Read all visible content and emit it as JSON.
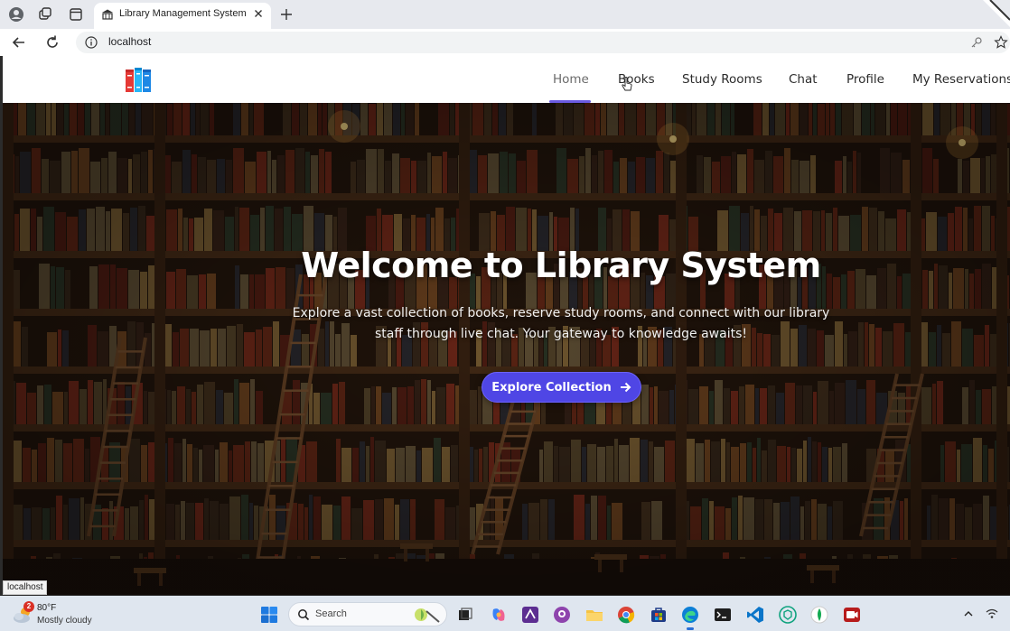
{
  "browser": {
    "tab_title": "Library Management System",
    "url": "localhost",
    "status_url": "localhost"
  },
  "site": {
    "nav": {
      "items": [
        {
          "label": "Home",
          "active": true
        },
        {
          "label": "Books",
          "active": false
        },
        {
          "label": "Study Rooms",
          "active": false
        },
        {
          "label": "Chat",
          "active": false
        },
        {
          "label": "Profile",
          "active": false
        },
        {
          "label": "My Reservations",
          "active": false
        }
      ]
    },
    "hero": {
      "title": "Welcome to Library System",
      "subtitle_line1": "Explore a vast collection of books, reserve study rooms, and connect with our library",
      "subtitle_line2": "staff through live chat. Your gateway to knowledge awaits!",
      "cta_label": "Explore Collection"
    },
    "colors": {
      "accent": "#4f46e5",
      "nav_underline": "#6a5ae0"
    }
  },
  "taskbar": {
    "weather_temp": "80°F",
    "weather_desc": "Mostly cloudy",
    "weather_badge": "2",
    "search_label": "Search",
    "apps": [
      "task-view",
      "copilot",
      "vs-studio",
      "github",
      "file-explorer",
      "chrome",
      "store",
      "edge",
      "terminal",
      "vscode",
      "chatgpt",
      "mongodb",
      "recorder"
    ]
  }
}
